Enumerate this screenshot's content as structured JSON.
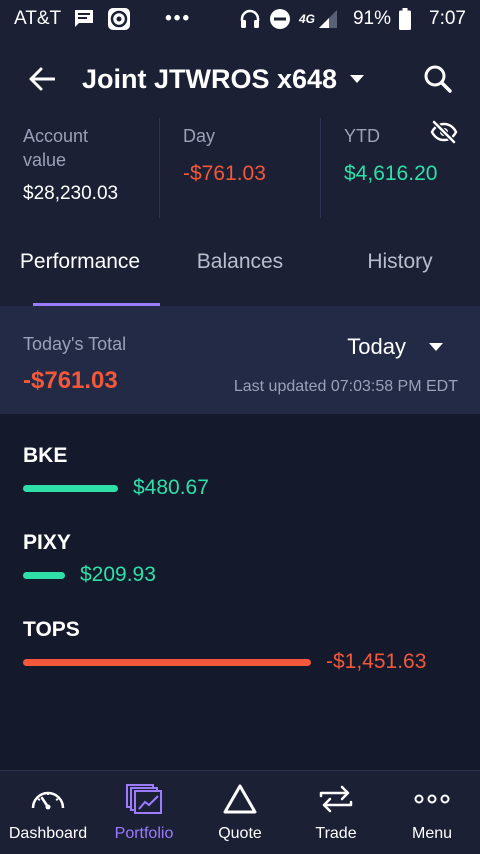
{
  "status_bar": {
    "carrier": "AT&T",
    "network": "4G",
    "battery": "91%",
    "time": "7:07"
  },
  "header": {
    "account_title": "Joint JTWROS x648"
  },
  "summary": {
    "account_value_label": "Account value",
    "account_value": "$28,230.03",
    "day_label": "Day",
    "day_value": "-$761.03",
    "ytd_label": "YTD",
    "ytd_value": "$4,616.20"
  },
  "tabs": [
    {
      "label": "Performance",
      "active": true
    },
    {
      "label": "Balances",
      "active": false
    },
    {
      "label": "History",
      "active": false
    }
  ],
  "total": {
    "label": "Today's Total",
    "value": "-$761.03",
    "range": "Today",
    "last_updated": "Last updated 07:03:58 PM EDT"
  },
  "holdings": [
    {
      "symbol": "BKE",
      "value": "$480.67",
      "amount": 480.67,
      "direction": "positive"
    },
    {
      "symbol": "PIXY",
      "value": "$209.93",
      "amount": 209.93,
      "direction": "positive"
    },
    {
      "symbol": "TOPS",
      "value": "-$1,451.63",
      "amount": -1451.63,
      "direction": "negative"
    }
  ],
  "bottom_nav": [
    {
      "label": "Dashboard",
      "icon": "gauge-icon",
      "active": false
    },
    {
      "label": "Portfolio",
      "icon": "portfolio-icon",
      "active": true
    },
    {
      "label": "Quote",
      "icon": "triangle-icon",
      "active": false
    },
    {
      "label": "Trade",
      "icon": "swap-arrows-icon",
      "active": false
    },
    {
      "label": "Menu",
      "icon": "more-dots-icon",
      "active": false
    }
  ],
  "colors": {
    "background": "#15192c",
    "surface": "#1b2035",
    "accent": "#9b7bff",
    "positive": "#2ee0a8",
    "negative": "#f4573a"
  }
}
